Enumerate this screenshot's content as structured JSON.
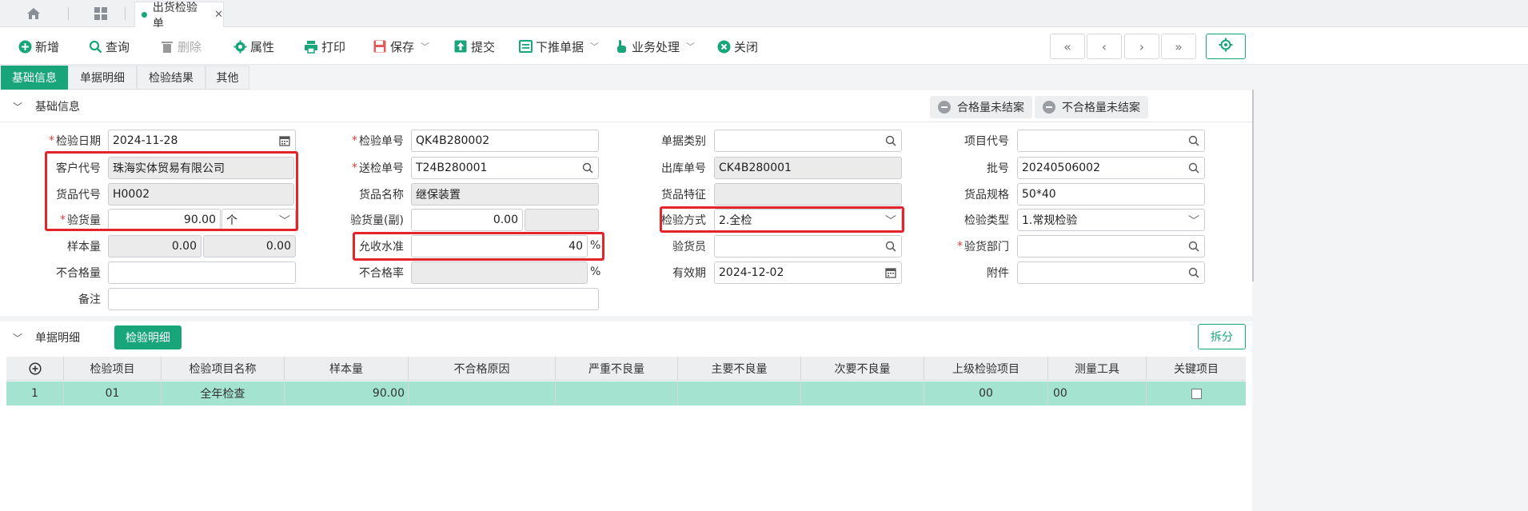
{
  "tabs": {
    "document_tab": "出货检验单"
  },
  "toolbar": {
    "add": "新增",
    "query": "查询",
    "delete": "删除",
    "properties": "属性",
    "print": "打印",
    "save": "保存",
    "submit": "提交",
    "push_down": "下推单据",
    "business": "业务处理",
    "close": "关闭"
  },
  "subtabs": [
    "基础信息",
    "单据明细",
    "检验结果",
    "其他"
  ],
  "basic_section": {
    "title": "基础信息",
    "status_buttons": [
      "合格量未结案",
      "不合格量未结案"
    ]
  },
  "form": {
    "inspect_date": {
      "label": "检验日期",
      "value": "2024-11-28"
    },
    "customer_code": {
      "label": "客户代号",
      "value": "珠海实体贸易有限公司"
    },
    "goods_code": {
      "label": "货品代号",
      "value": "H0002"
    },
    "inspect_qty": {
      "label": "验货量",
      "value": "90.00",
      "unit": "个"
    },
    "sample_qty": {
      "label": "样本量",
      "value1": "0.00",
      "value2": "0.00"
    },
    "defect_qty": {
      "label": "不合格量",
      "value": ""
    },
    "remark": {
      "label": "备注",
      "value": ""
    },
    "inspect_no": {
      "label": "检验单号",
      "value": "QK4B280002"
    },
    "send_no": {
      "label": "送检单号",
      "value": "T24B280001"
    },
    "goods_name": {
      "label": "货品名称",
      "value": "继保装置"
    },
    "inspect_qty_sub": {
      "label": "验货量(副)",
      "value": "0.00",
      "value2": ""
    },
    "accept_level": {
      "label": "允收水准",
      "value": "40",
      "unit": "%"
    },
    "defect_rate": {
      "label": "不合格率",
      "value": "",
      "unit": "%"
    },
    "doc_type": {
      "label": "单据类别",
      "value": ""
    },
    "outbound_no": {
      "label": "出库单号",
      "value": "CK4B280001"
    },
    "goods_feature": {
      "label": "货品特征",
      "value": ""
    },
    "inspect_method": {
      "label": "检验方式",
      "value": "2.全检"
    },
    "inspector": {
      "label": "验货员",
      "value": ""
    },
    "valid_date": {
      "label": "有效期",
      "value": "2024-12-02"
    },
    "project_code": {
      "label": "项目代号",
      "value": ""
    },
    "batch_no": {
      "label": "批号",
      "value": "20240506002"
    },
    "goods_spec": {
      "label": "货品规格",
      "value": "50*40"
    },
    "inspect_type": {
      "label": "检验类型",
      "value": "1.常规检验"
    },
    "inspect_dept": {
      "label": "验货部门",
      "value": ""
    },
    "attachment": {
      "label": "附件",
      "value": ""
    }
  },
  "detail_section": {
    "title": "单据明细",
    "tab": "检验明细",
    "split_button": "拆分"
  },
  "table": {
    "columns": [
      "检验项目",
      "检验项目名称",
      "样本量",
      "不合格原因",
      "严重不良量",
      "主要不良量",
      "次要不良量",
      "上级检验项目",
      "测量工具",
      "关键项目"
    ],
    "rows": [
      {
        "index": "1",
        "item": "01",
        "name": "全年检查",
        "sample": "90.00",
        "reason": "",
        "severe": "",
        "major": "",
        "minor": "",
        "parent": "00",
        "tool": "00"
      }
    ]
  },
  "colors": {
    "accent": "#19a57a",
    "highlight": "#e3242b",
    "row_selected": "#a3e3cf"
  }
}
